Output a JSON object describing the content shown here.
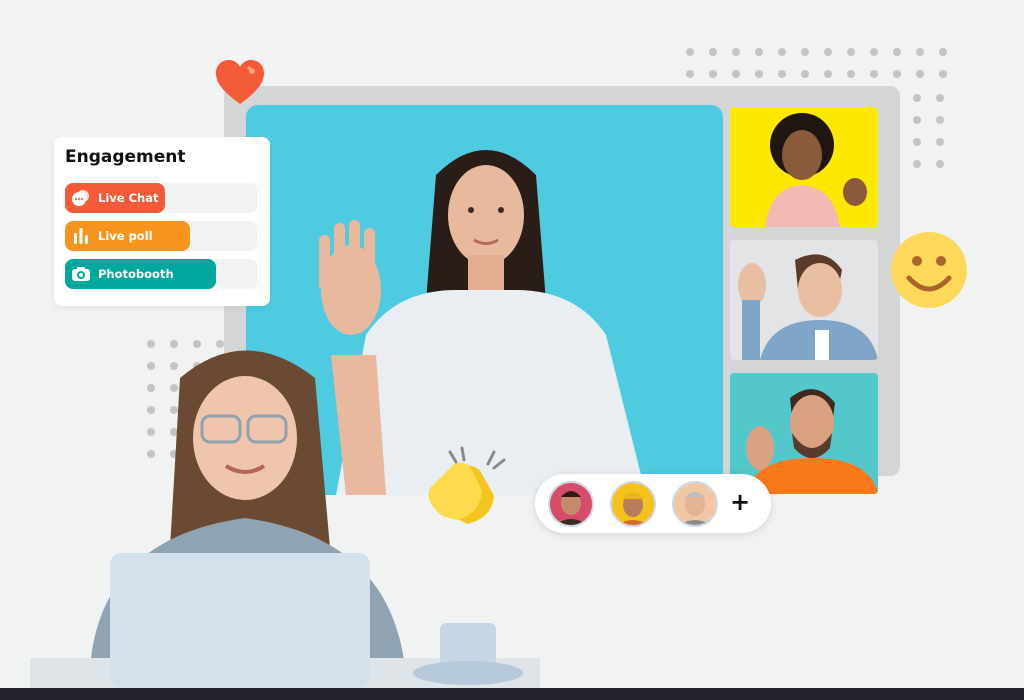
{
  "engagement": {
    "title": "Engagement",
    "items": [
      {
        "label": "Live Chat",
        "icon": "chat-bubbles-icon",
        "color": "#f25a38",
        "fill": 0.52
      },
      {
        "label": "Live poll",
        "icon": "bar-chart-icon",
        "color": "#f7941d",
        "fill": 0.65
      },
      {
        "label": "Photobooth",
        "icon": "camera-icon",
        "color": "#00a79d",
        "fill": 0.78
      }
    ]
  },
  "participants_bar": {
    "more_label": "+"
  },
  "colors": {
    "background": "#f1f2f2",
    "frame": "#d4d5d7",
    "main_video_bg": "#4ecbe0",
    "heart": "#f25a38",
    "smiley": "#fcd95b",
    "bottom_bar": "#22232b"
  }
}
